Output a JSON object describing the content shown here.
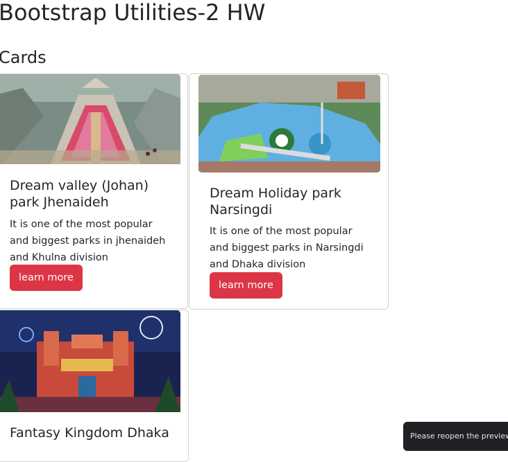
{
  "page": {
    "title": "Bootstrap Utilities-2 HW",
    "section_title": "Cards"
  },
  "cards": [
    {
      "image_alt": "Dream valley park photo",
      "title": "Dream valley (Johan) park Jhenaideh",
      "text": "It is one of the most popular and biggest parks in jhenaideh and Khulna division",
      "button": "learn more"
    },
    {
      "image_alt": "Dream Holiday park aerial photo",
      "title": "Dream Holiday park Narsingdi",
      "text": "It is one of the most popular and biggest parks in Narsingdi and Dhaka division",
      "button": "learn more"
    },
    {
      "image_alt": "Fantasy Kingdom night photo",
      "title": "Fantasy Kingdom Dhaka",
      "text": "",
      "button": ""
    }
  ],
  "toast": {
    "message": "Please reopen the preview."
  },
  "colors": {
    "button_danger": "#dc3545",
    "text": "#212529",
    "toast_bg": "#1f2124"
  }
}
